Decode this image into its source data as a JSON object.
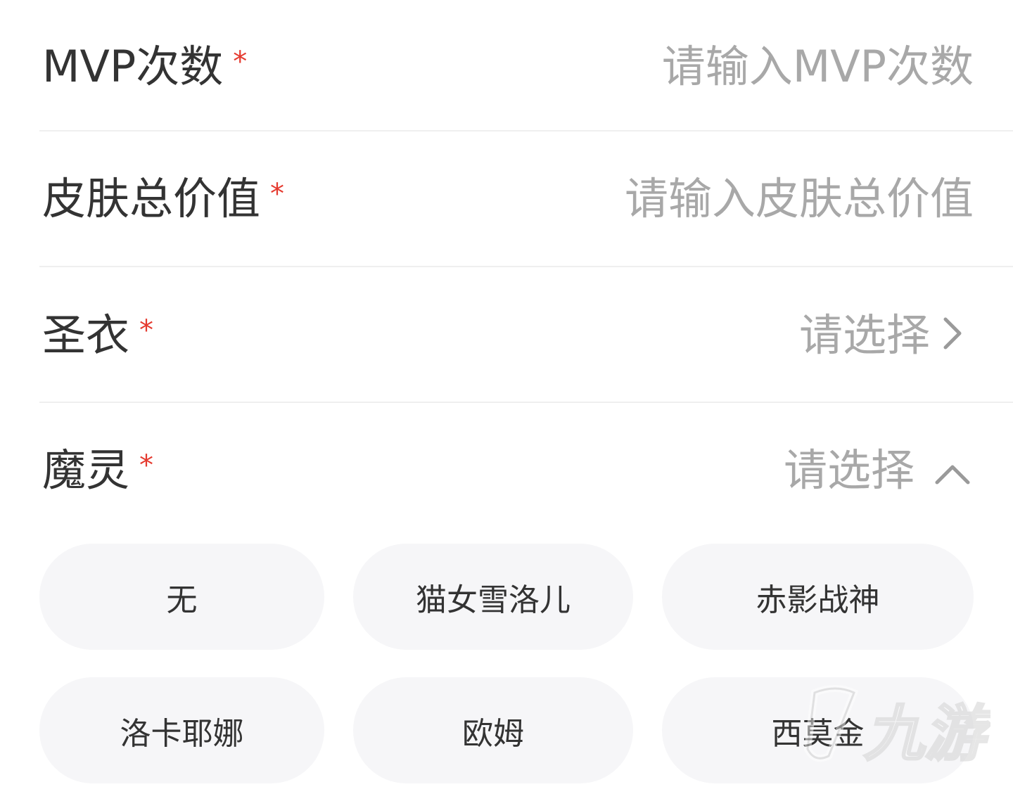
{
  "fields": [
    {
      "label": "MVP次数",
      "required_mark": "*",
      "placeholder": "请输入MVP次数"
    },
    {
      "label": "皮肤总价值",
      "required_mark": "*",
      "placeholder": "请输入皮肤总价值"
    },
    {
      "label": "圣衣",
      "required_mark": "*",
      "placeholder": "请选择",
      "icon": "chevron-right-icon"
    },
    {
      "label": "魔灵",
      "required_mark": "*",
      "placeholder": "请选择",
      "icon": "chevron-up-icon"
    }
  ],
  "moling_options": [
    "无",
    "猫女雪洛儿",
    "赤影战神",
    "洛卡耶娜",
    "欧姆",
    "西莫金"
  ],
  "watermark": {
    "text": "九游"
  },
  "colors": {
    "required": "#e53a2f",
    "placeholder": "#a8a8a8",
    "text": "#333333",
    "chip_bg": "#f6f6f8",
    "divider": "#efefef"
  }
}
